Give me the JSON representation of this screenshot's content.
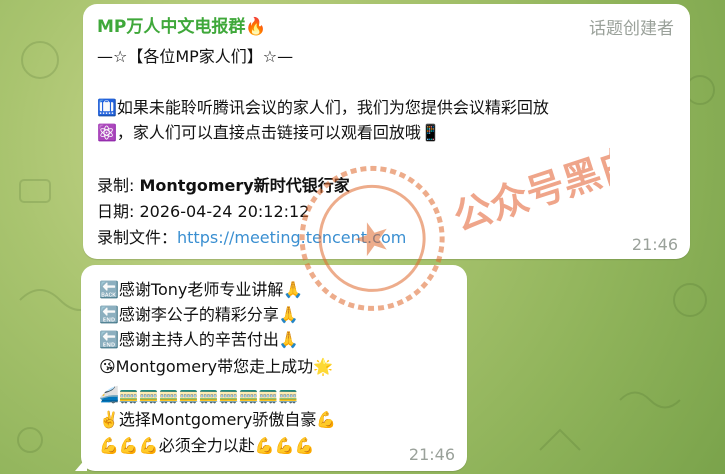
{
  "chat": {
    "msg1": {
      "sender": "MP万人中文电报群🔥",
      "role": "话题创建者",
      "line1": "—☆【各位MP家人们】☆—",
      "line2": "  🛄如果未能聆听腾讯会议的家人们，我们为您提供会议精彩回放",
      "line3": "⚛️，家人们可以直接点击链接可以观看回放哦📱",
      "rec_label": "录制: ",
      "rec_value": "Montgomery新时代银行家",
      "date_label": "日期: ",
      "date_value": "2026-04-24 20:12:12",
      "file_label": "录制文件：",
      "file_link": "https://meeting.tencent.com",
      "time": "21:46"
    },
    "msg2": {
      "line1": "🔙感谢Tony老师专业讲解🙏",
      "line2": "    🔚感谢李公子的精彩分享🙏",
      "line3": "    🔚感谢主持人的辛苦付出🙏",
      "line4": "😘Montgomery带您走上成功🌟",
      "line5": "🚄🚃🚃🚃🚃🚃🚃🚃🚃🚃",
      "line6": "✌️选择Montgomery骄傲自豪💪",
      "line7": "💪💪💪必须全力以赴💪💪💪",
      "time": "21:46"
    },
    "watermark": "公众号黑白之猫"
  }
}
